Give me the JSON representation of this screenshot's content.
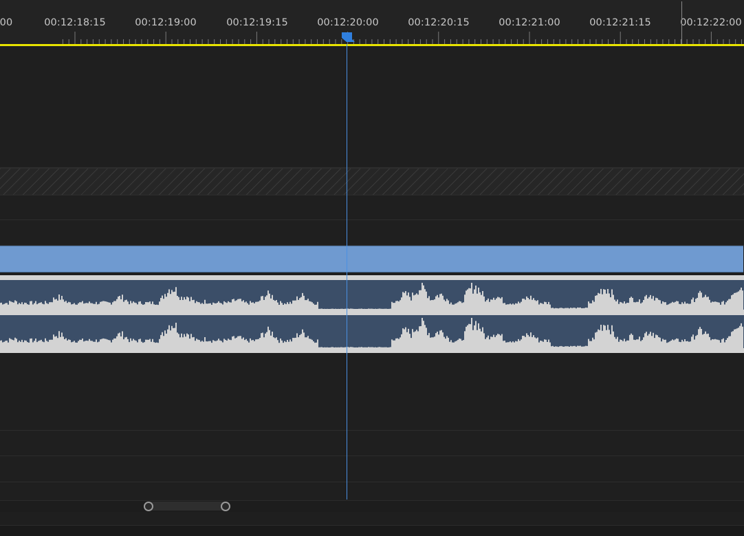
{
  "timeline": {
    "timecodes": [
      "00",
      "00:12:18:15",
      "00:12:19:00",
      "00:12:19:15",
      "00:12:20:00",
      "00:12:20:15",
      "00:12:21:00",
      "00:12:21:15",
      "00:12:22:00"
    ],
    "playhead_timecode": "00:12:20:00"
  },
  "colors": {
    "work_area_bar": "#e8e300",
    "playhead": "#4a90e2",
    "video_clip": "#6f9ad0",
    "audio_clip_bg": "#3b4e68",
    "waveform": "#d3d3d3"
  },
  "icons": {
    "playhead": "playhead-marker-icon",
    "scroll_handle_left": "scroll-handle-circle-icon",
    "scroll_handle_right": "scroll-handle-circle-icon"
  }
}
